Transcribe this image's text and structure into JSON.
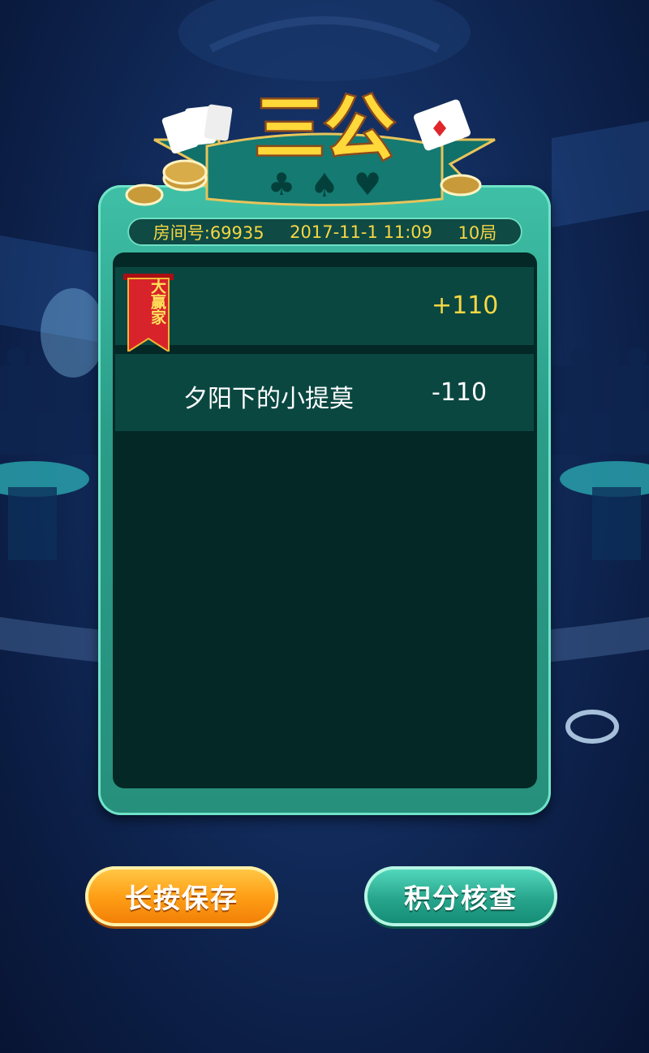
{
  "title": "三公",
  "room_info": {
    "room_label": "房间号:69935",
    "datetime": "2017-11-1 11:09",
    "rounds": "10局"
  },
  "winner_badge": "大赢家",
  "players": [
    {
      "name": "",
      "score": "+110",
      "is_winner": true
    },
    {
      "name": "夕阳下的小提莫",
      "score": "-110",
      "is_winner": false
    }
  ],
  "buttons": {
    "save": "长按保存",
    "check": "积分核查"
  },
  "colors": {
    "accent_gold": "#f6d743",
    "panel_teal": "#2a9c88",
    "button_orange": "#ff9f16",
    "button_teal": "#27a58c"
  },
  "icons": [
    "club-icon",
    "spade-icon",
    "heart-icon",
    "chip-icon",
    "playing-card-icon",
    "winner-ribbon-icon"
  ]
}
